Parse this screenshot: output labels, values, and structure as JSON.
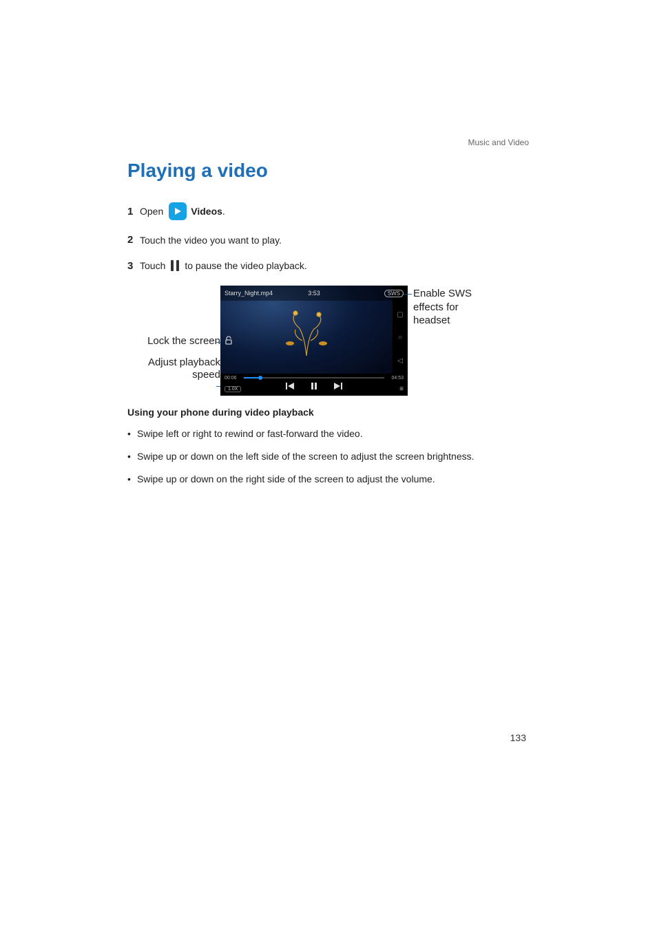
{
  "breadcrumb": "Music and Video",
  "title": "Playing a video",
  "steps": {
    "s1": {
      "num": "1",
      "pre": "Open",
      "app": "Videos",
      "post": "."
    },
    "s2": {
      "num": "2",
      "text": "Touch the video you want to play."
    },
    "s3": {
      "num": "3",
      "pre": "Touch",
      "post": "to pause the video playback."
    }
  },
  "callouts": {
    "lock": "Lock the screen",
    "speed": "Adjust playback speed",
    "sws": "Enable SWS effects for headset"
  },
  "player": {
    "filename": "Starry_Night.mp4",
    "clock": "3:53",
    "sws_label": "SWS",
    "t_cur": "00:06",
    "t_total": "04:53",
    "speed": "1.0X",
    "nav_square": "▢",
    "nav_circle": "○",
    "nav_back": "◁",
    "hamburger": "≡"
  },
  "subhead": "Using your phone during video playback",
  "bullets": [
    "Swipe left or right to rewind or fast-forward the video.",
    "Swipe up or down on the left side of the screen to adjust the screen brightness.",
    "Swipe up or down on the right side of the screen to adjust the volume."
  ],
  "page_number": "133"
}
